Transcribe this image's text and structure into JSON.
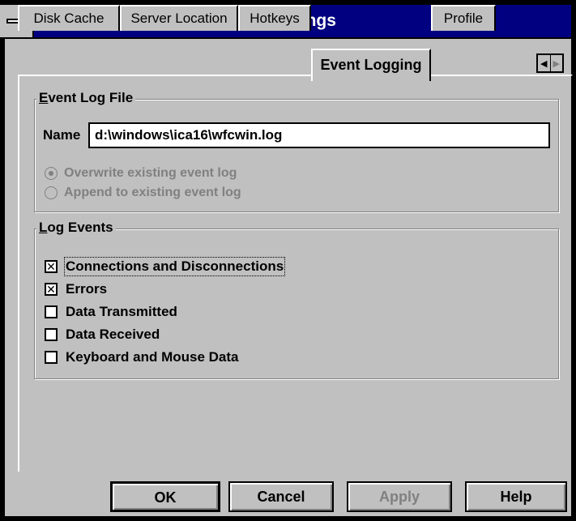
{
  "window": {
    "title": "Settings"
  },
  "tabs": [
    {
      "label": "Disk Cache"
    },
    {
      "label": "Server Location"
    },
    {
      "label": "Hotkeys"
    },
    {
      "label": "Event Logging",
      "active": true
    },
    {
      "label": "Profile"
    }
  ],
  "event_log_file": {
    "legend_underlined": "E",
    "legend_rest": "vent Log File",
    "name_label": "Name",
    "name_value": "d:\\windows\\ica16\\wfcwin.log",
    "options": [
      {
        "label": "Overwrite existing event log",
        "selected": true,
        "enabled": false
      },
      {
        "label": "Append to existing event log",
        "selected": false,
        "enabled": false
      }
    ]
  },
  "log_events": {
    "legend_underlined": "L",
    "legend_rest": "og Events",
    "items": [
      {
        "label": "Connections and Disconnections",
        "checked": true,
        "focused": true
      },
      {
        "label": "Errors",
        "checked": true
      },
      {
        "label": "Data Transmitted",
        "checked": false
      },
      {
        "label": "Data Received",
        "checked": false
      },
      {
        "label": "Keyboard and Mouse Data",
        "checked": false
      }
    ]
  },
  "buttons": {
    "ok": "OK",
    "cancel": "Cancel",
    "apply": "Apply",
    "help": "Help"
  },
  "colors": {
    "face": "#c0c0c0",
    "titlebar": "#000080",
    "disabled_text": "#808080"
  }
}
